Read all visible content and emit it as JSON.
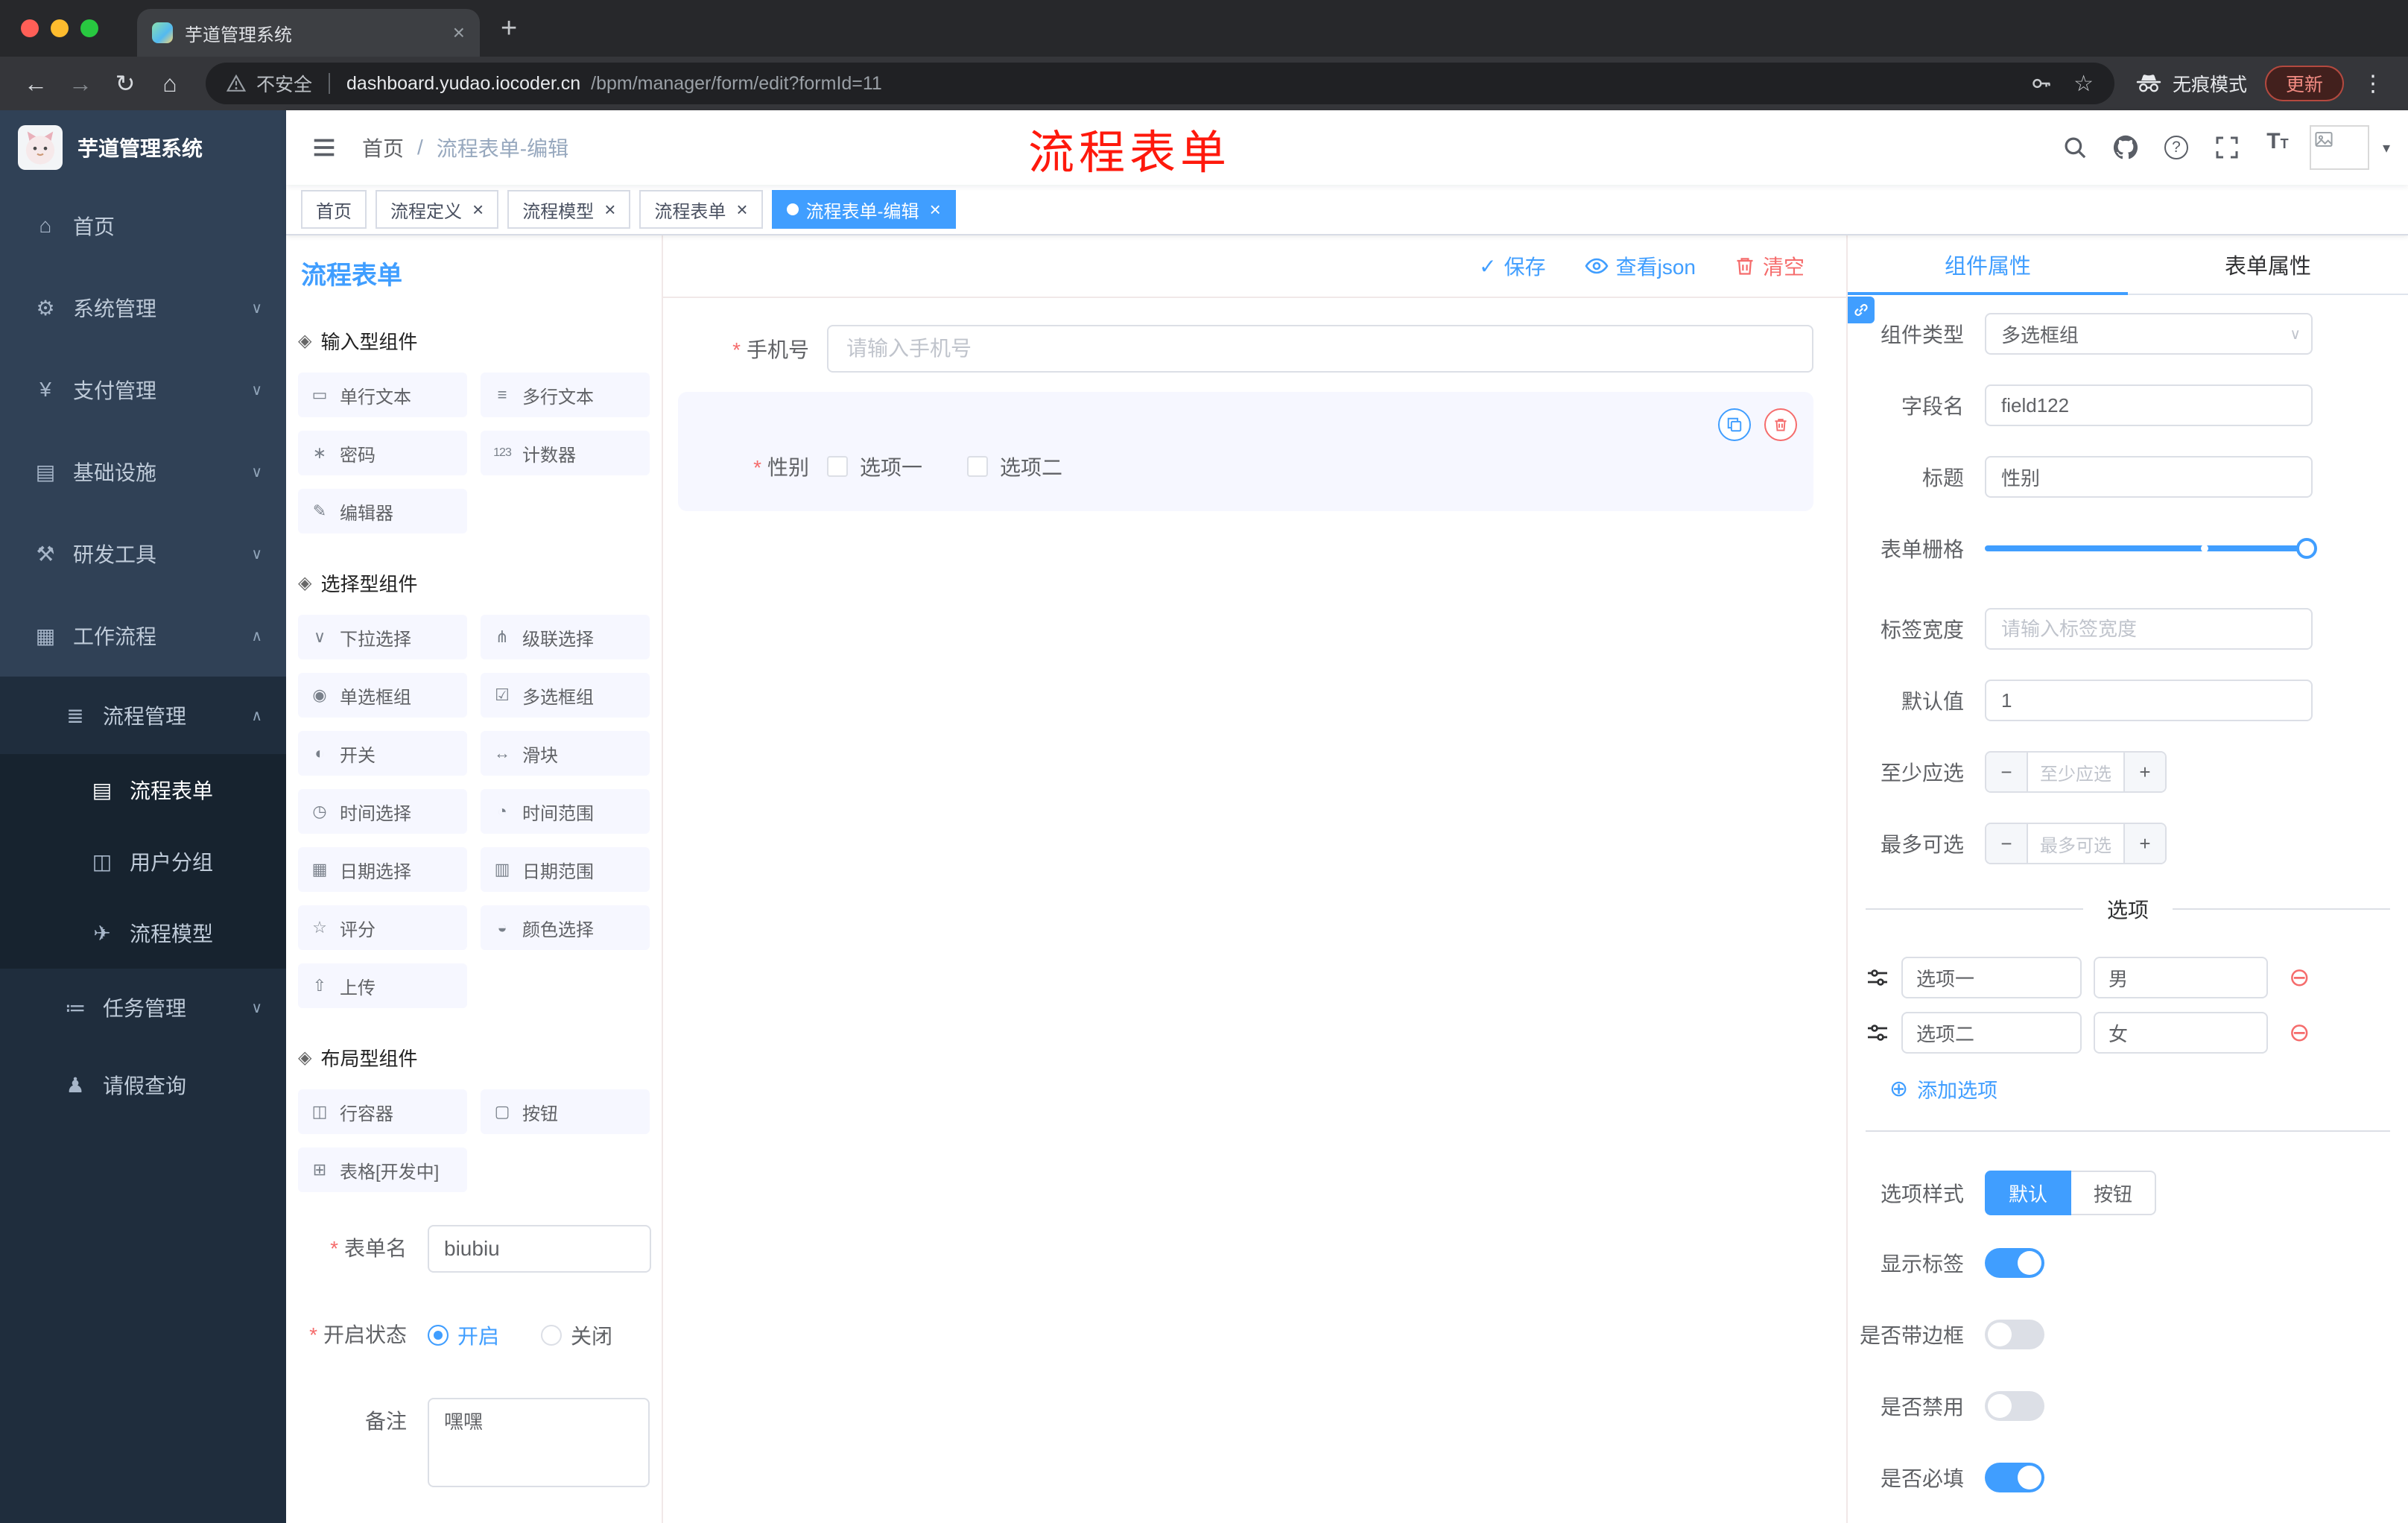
{
  "icons": {
    "back": "←",
    "forward": "→",
    "reload": "↻",
    "home": "⌂",
    "close": "×",
    "new_tab": "+",
    "star": "☆",
    "dots_vertical": "⋮",
    "chevron_down": "∨",
    "chevron_up": "∧",
    "caret_down": "▾",
    "check": "✓",
    "minus": "−",
    "plus": "+",
    "add_circle": "⊕",
    "remove_circle": "⊖",
    "question": "?",
    "slash": "/",
    "font_size_big": "T",
    "font_size_small": "T"
  },
  "browser": {
    "tab_title": "芋道管理系统",
    "security_label": "不安全",
    "url_host": "dashboard.yudao.iocoder.cn",
    "url_path": "/bpm/manager/form/edit?formId=11",
    "incognito_label": "无痕模式",
    "update_label": "更新"
  },
  "sidebar": {
    "logo_title": "芋道管理系统",
    "items": [
      {
        "glyph": "⌂",
        "label": "首页"
      },
      {
        "glyph": "⚙",
        "label": "系统管理"
      },
      {
        "glyph": "¥",
        "label": "支付管理"
      },
      {
        "glyph": "▤",
        "label": "基础设施"
      },
      {
        "glyph": "⚒",
        "label": "研发工具"
      },
      {
        "glyph": "▦",
        "label": "工作流程"
      },
      {
        "glyph": "≣",
        "label": "流程管理"
      },
      {
        "glyph": "▤",
        "label": "流程表单"
      },
      {
        "glyph": "◫",
        "label": "用户分组"
      },
      {
        "glyph": "✈",
        "label": "流程模型"
      },
      {
        "glyph": "≔",
        "label": "任务管理"
      },
      {
        "glyph": "♟",
        "label": "请假查询"
      }
    ]
  },
  "header": {
    "breadcrumb_home": "首页",
    "breadcrumb_sep": "/",
    "breadcrumb_current": "流程表单-编辑",
    "overlay_text": "流程表单"
  },
  "tags": [
    {
      "label": "首页"
    },
    {
      "label": "流程定义"
    },
    {
      "label": "流程模型"
    },
    {
      "label": "流程表单"
    },
    {
      "label": "流程表单-编辑"
    }
  ],
  "editor": {
    "panel_title": "流程表单",
    "actions": {
      "save": "保存",
      "view_json": "查看json",
      "clear": "清空"
    },
    "palette": {
      "groups": [
        {
          "title": "输入型组件",
          "items": [
            {
              "glyph": "▭",
              "label": "单行文本"
            },
            {
              "glyph": "≡",
              "label": "多行文本"
            },
            {
              "glyph": "∗",
              "label": "密码"
            },
            {
              "glyph": "123",
              "label": "计数器"
            },
            {
              "glyph": "✎",
              "label": "编辑器"
            }
          ]
        },
        {
          "title": "选择型组件",
          "items": [
            {
              "glyph": "∨",
              "label": "下拉选择"
            },
            {
              "glyph": "⋔",
              "label": "级联选择"
            },
            {
              "glyph": "◉",
              "label": "单选框组"
            },
            {
              "glyph": "☑",
              "label": "多选框组"
            },
            {
              "glyph": "◐",
              "label": "开关"
            },
            {
              "glyph": "↔",
              "label": "滑块"
            },
            {
              "glyph": "◷",
              "label": "时间选择"
            },
            {
              "glyph": "◔",
              "label": "时间范围"
            },
            {
              "glyph": "▦",
              "label": "日期选择"
            },
            {
              "glyph": "▥",
              "label": "日期范围"
            },
            {
              "glyph": "☆",
              "label": "评分"
            },
            {
              "glyph": "◒",
              "label": "颜色选择"
            },
            {
              "glyph": "⇧",
              "label": "上传"
            }
          ]
        },
        {
          "title": "布局型组件",
          "items": [
            {
              "glyph": "◫",
              "label": "行容器"
            },
            {
              "glyph": "▢",
              "label": "按钮"
            },
            {
              "glyph": "⊞",
              "label": "表格[开发中]"
            }
          ]
        }
      ]
    },
    "meta_form": {
      "name_label": "表单名",
      "name_value": "biubiu",
      "status_label": "开启状态",
      "status_on": "开启",
      "status_off": "关闭",
      "remark_label": "备注",
      "remark_value": "嘿嘿"
    },
    "canvas": {
      "phone_label": "手机号",
      "phone_placeholder": "请输入手机号",
      "gender_label": "性别",
      "gender_option1": "选项一",
      "gender_option2": "选项二"
    },
    "props": {
      "tab_component": "组件属性",
      "tab_form": "表单属性",
      "type_label": "组件类型",
      "type_value": "多选框组",
      "field_label": "字段名",
      "field_value": "field122",
      "title_label": "标题",
      "title_value": "性别",
      "grid_label": "表单栅格",
      "labelwidth_label": "标签宽度",
      "labelwidth_placeholder": "请输入标签宽度",
      "default_label": "默认值",
      "default_value": "1",
      "min_label": "至少应选",
      "min_placeholder": "至少应选",
      "max_label": "最多可选",
      "max_placeholder": "最多可选",
      "options_divider": "选项",
      "option_rows": [
        {
          "name": "选项一",
          "value": "男"
        },
        {
          "name": "选项二",
          "value": "女"
        }
      ],
      "add_option": "添加选项",
      "style_label": "选项样式",
      "style_default": "默认",
      "style_button": "按钮",
      "show_label": "显示标签",
      "border_label": "是否带边框",
      "disabled_label": "是否禁用",
      "required_label": "是否必填"
    }
  },
  "colors": {
    "primary": "#409EFF",
    "danger": "#F56C6C",
    "sidebar_bg": "#304156",
    "sidebar_sub_bg": "#1F2D3D",
    "annotation_red": "#FE190C",
    "active_tag_bg": "#409EFF"
  }
}
